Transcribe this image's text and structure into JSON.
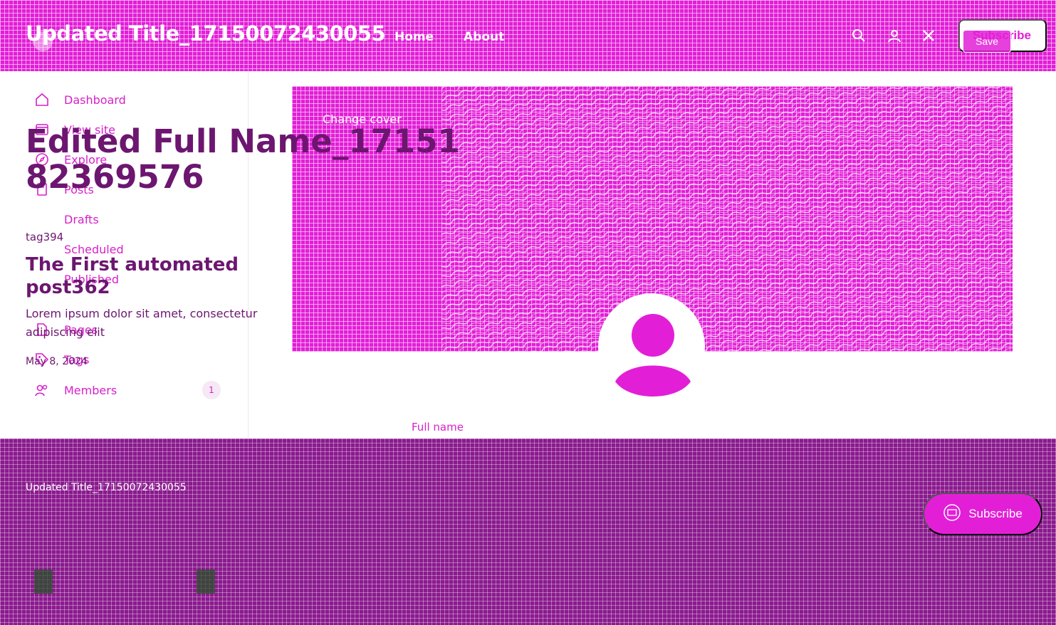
{
  "header": {
    "site_title": "Updated Title_17150072430055",
    "nav": [
      {
        "label": "Home"
      },
      {
        "label": "About"
      }
    ],
    "subscribe_label": "Subscribe",
    "save_label": "Save"
  },
  "sidebar": {
    "items": [
      {
        "label": "Dashboard",
        "icon": "home-icon"
      },
      {
        "label": "View site",
        "icon": "window-icon"
      },
      {
        "label": "Explore",
        "icon": "compass-icon"
      },
      {
        "label": "Posts",
        "icon": "pen-icon"
      },
      {
        "label": "Drafts"
      },
      {
        "label": "Scheduled"
      },
      {
        "label": "Published"
      },
      {
        "label": "Pages",
        "icon": "document-icon"
      },
      {
        "label": "Tags",
        "icon": "tag-icon"
      },
      {
        "label": "Members",
        "icon": "members-icon",
        "count": "1"
      }
    ]
  },
  "post": {
    "author_name": "Edited Full Name_1715182369576",
    "tag": "tag394",
    "title": "The First automated post362",
    "excerpt": "Lorem ipsum dolor sit amet, consectetur adipiscing elit",
    "meta": "May 8, 2024"
  },
  "profile": {
    "change_cover_label": "Change cover",
    "full_name_label": "Full name"
  },
  "footer": {
    "site_title": "Updated Title_17150072430055",
    "subscribe_label": "Subscribe"
  },
  "colors": {
    "accent": "#e21fd7",
    "footer_bg": "#8a1a8e",
    "text_dark": "#6c1670"
  }
}
